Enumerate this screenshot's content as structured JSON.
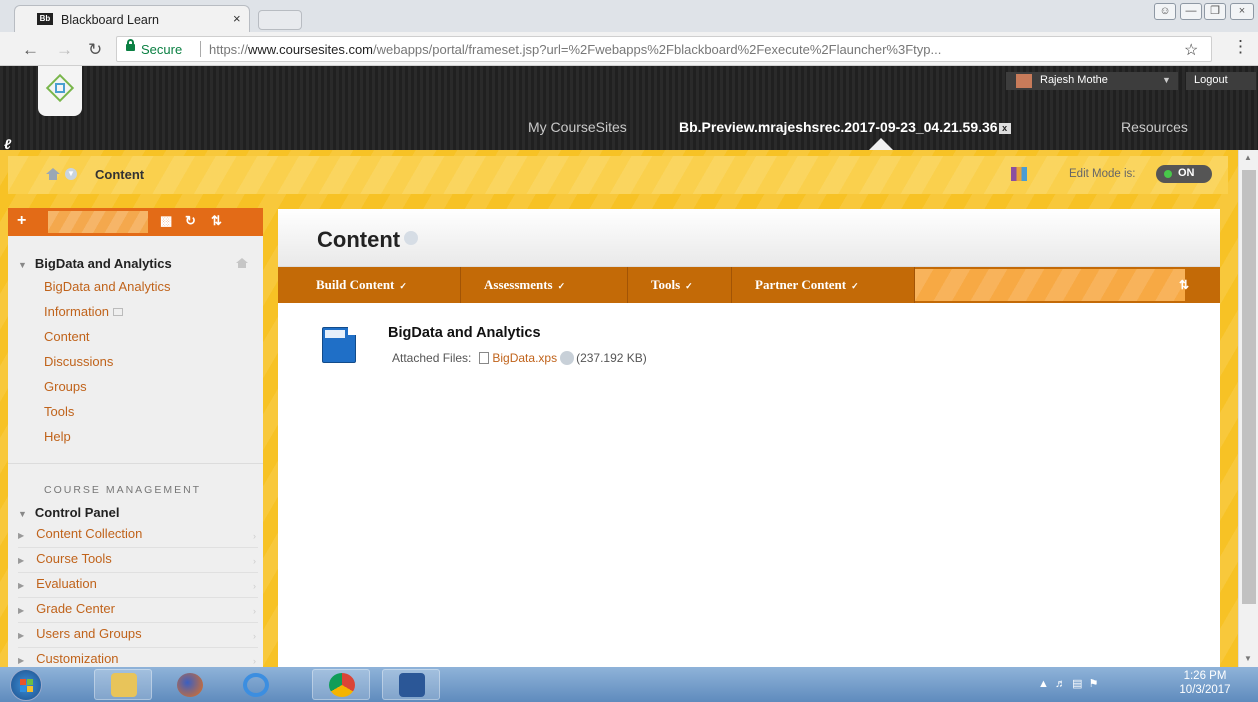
{
  "browser": {
    "tab_title": "Blackboard Learn",
    "favicon_text": "Bb",
    "secure_label": "Secure",
    "url_prefix": "https://",
    "url_host": "www.coursesites.com",
    "url_path": "/webapps/portal/frameset.jsp?url=%2Fwebapps%2Fblackboard%2Fexecute%2Flauncher%3Ftyp...",
    "close_tab_glyph": "×"
  },
  "header": {
    "user_name": "Rajesh Mothe",
    "logout_label": "Logout",
    "nav": [
      "My CourseSites",
      "Bb.Preview.mrajeshsrec.2017-09-23_04.21.59.36",
      "Resources"
    ],
    "env_badge": "x"
  },
  "breadcrumb": {
    "current": "Content"
  },
  "edit_mode": {
    "label": "Edit Mode is:",
    "state": "ON",
    "state_color": "#48c84a"
  },
  "course_menu": {
    "course_title": "BigData and Analytics",
    "items": [
      "BigData and Analytics",
      "Information",
      "Content",
      "Discussions",
      "Groups",
      "Tools",
      "Help"
    ],
    "management_heading": "COURSE MANAGEMENT",
    "control_panel_title": "Control Panel",
    "control_panel_items": [
      "Content Collection",
      "Course Tools",
      "Evaluation",
      "Grade Center",
      "Users and Groups",
      "Customization"
    ]
  },
  "content": {
    "page_title": "Content",
    "actions": [
      "Build Content",
      "Assessments",
      "Tools",
      "Partner Content"
    ],
    "item_title": "BigData and Analytics",
    "attached_label": "Attached Files:",
    "file_name": "BigData.xps",
    "file_size": "(237.192 KB)"
  },
  "taskbar": {
    "time": "1:26 PM",
    "date": "10/3/2017"
  },
  "colors": {
    "accent_orange": "#c36a07",
    "link_orange": "#c0631b",
    "frame_yellow": "#f7c225"
  }
}
